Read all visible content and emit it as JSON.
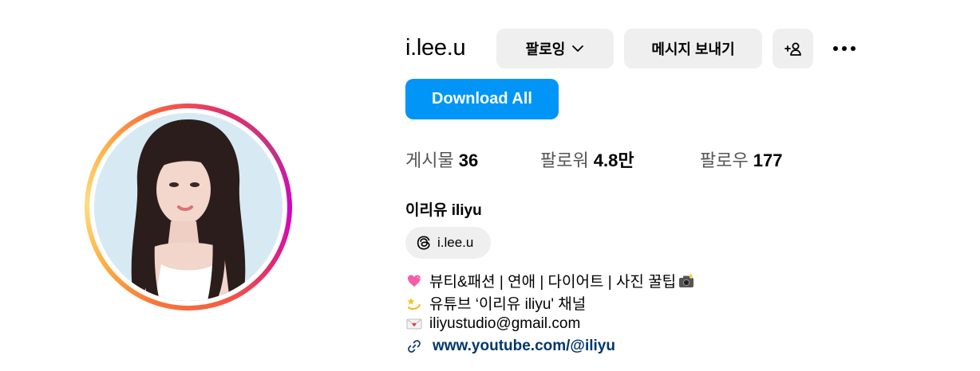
{
  "profile": {
    "username": "i.lee.u",
    "full_name": "이리유 iliyu",
    "threads_handle": "i.lee.u",
    "avatar_icon": "profile-photo"
  },
  "actions": {
    "following_label": "팔로잉",
    "message_label": "메시지 보내기",
    "add_user_icon": "add-user-icon",
    "more_icon": "more-options-icon",
    "download_label": "Download All"
  },
  "stats": {
    "posts_label": "게시물",
    "posts_value": "36",
    "followers_label": "팔로워",
    "followers_value": "4.8만",
    "following_label": "팔로우",
    "following_value": "177"
  },
  "bio": {
    "line1": "뷰티&패션 | 연애 | 다이어트 | 사진 꿀팁",
    "line2": "유튜브 ‘이리유 iliyu' 채널",
    "line3": "iliyustudio@gmail.com",
    "link": "www.youtube.com/@iliyu"
  },
  "colors": {
    "primary_button": "#0095f6",
    "secondary_button": "#efefef",
    "link": "#00376b"
  }
}
